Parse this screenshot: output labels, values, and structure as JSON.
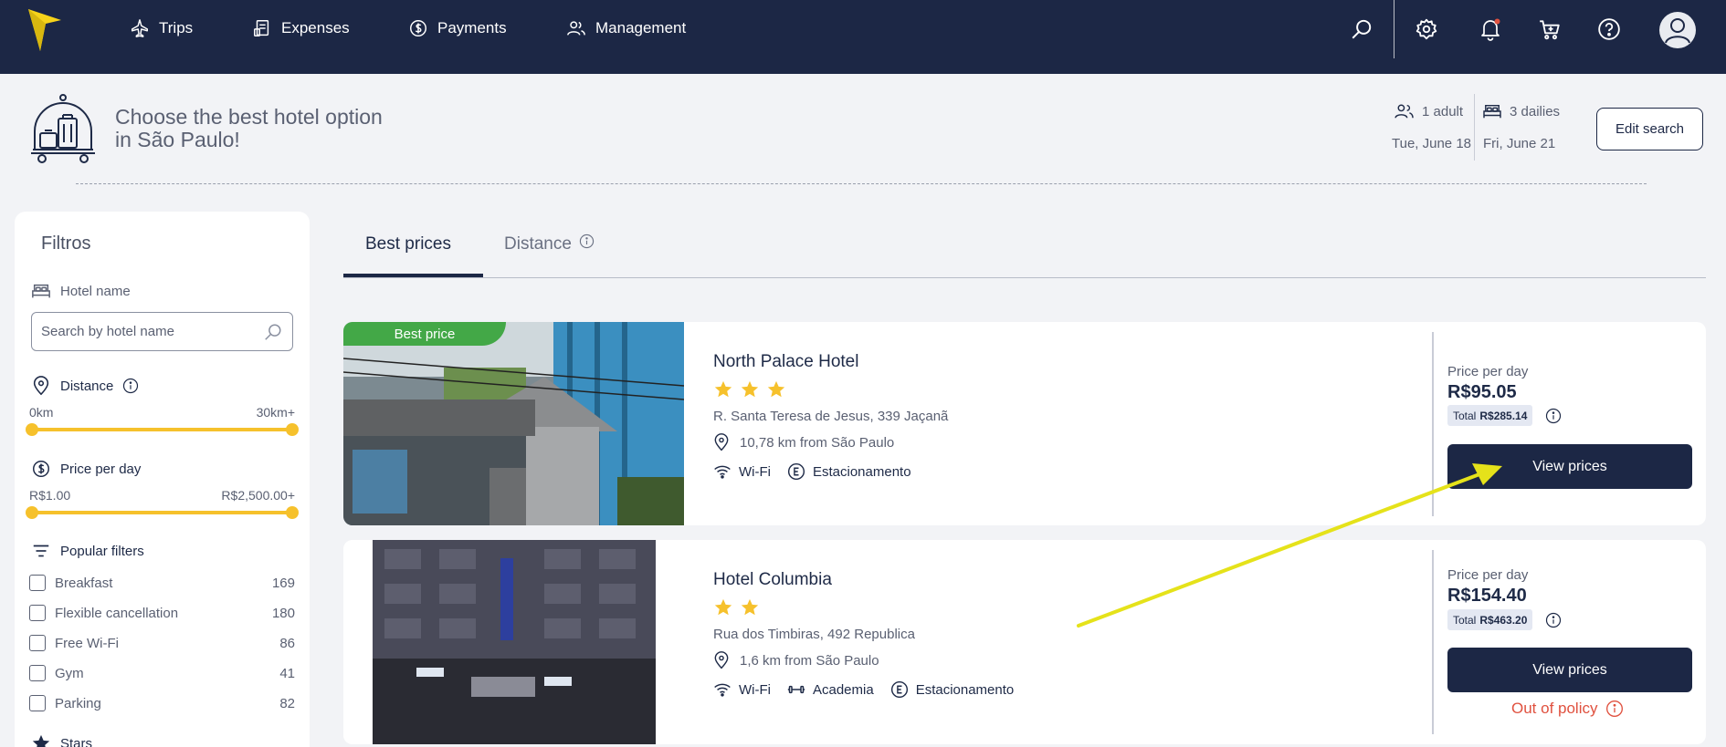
{
  "nav": {
    "items": [
      {
        "label": "Trips",
        "icon": "plane-icon"
      },
      {
        "label": "Expenses",
        "icon": "receipt-icon"
      },
      {
        "label": "Payments",
        "icon": "dollar-circle-icon"
      },
      {
        "label": "Management",
        "icon": "users-icon"
      }
    ],
    "right_icons": [
      "search-icon",
      "gear-icon",
      "bell-icon",
      "cart-icon",
      "help-icon",
      "avatar"
    ]
  },
  "header": {
    "title": "Choose the best hotel option in São Paulo!",
    "guests": "1 adult",
    "dailies": "3 dailies",
    "checkin": "Tue, June 18",
    "checkout": "Fri, June 21",
    "edit_search": "Edit search"
  },
  "sidebar": {
    "title": "Filtros",
    "hotel_name_label": "Hotel name",
    "search_placeholder": "Search by hotel name",
    "distance_label": "Distance",
    "distance_min": "0km",
    "distance_max": "30km+",
    "price_label": "Price per day",
    "price_min": "R$1.00",
    "price_max": "R$2,500.00+",
    "popular_label": "Popular filters",
    "filters": [
      {
        "label": "Breakfast",
        "count": "169"
      },
      {
        "label": "Flexible cancellation",
        "count": "180"
      },
      {
        "label": "Free Wi-Fi",
        "count": "86"
      },
      {
        "label": "Gym",
        "count": "41"
      },
      {
        "label": "Parking",
        "count": "82"
      }
    ],
    "stars_label": "Stars"
  },
  "tabs": {
    "best_prices": "Best prices",
    "distance": "Distance"
  },
  "hotels": [
    {
      "badge": "Best price",
      "name": "North Palace Hotel",
      "stars": 3,
      "address": "R. Santa Teresa de Jesus, 339 Jaçanã",
      "distance": "10,78 km from São Paulo",
      "amenities": [
        "Wi-Fi",
        "Estacionamento"
      ],
      "price_label": "Price per day",
      "price": "R$95.05",
      "total_label": "Total",
      "total": "R$285.14",
      "button": "View prices"
    },
    {
      "name": "Hotel Columbia",
      "stars": 2,
      "address": "Rua dos Timbiras, 492 Republica",
      "distance": "1,6 km from São Paulo",
      "amenities": [
        "Wi-Fi",
        "Academia",
        "Estacionamento"
      ],
      "price_label": "Price per day",
      "price": "R$154.40",
      "total_label": "Total",
      "total": "R$463.20",
      "button": "View prices",
      "policy": "Out of policy"
    }
  ],
  "colors": {
    "navy": "#1c2745",
    "accent_yellow": "#f6c12c",
    "best_price_green": "#43a847",
    "out_of_policy_red": "#e0513f",
    "annotation_arrow": "#e5e21a"
  }
}
